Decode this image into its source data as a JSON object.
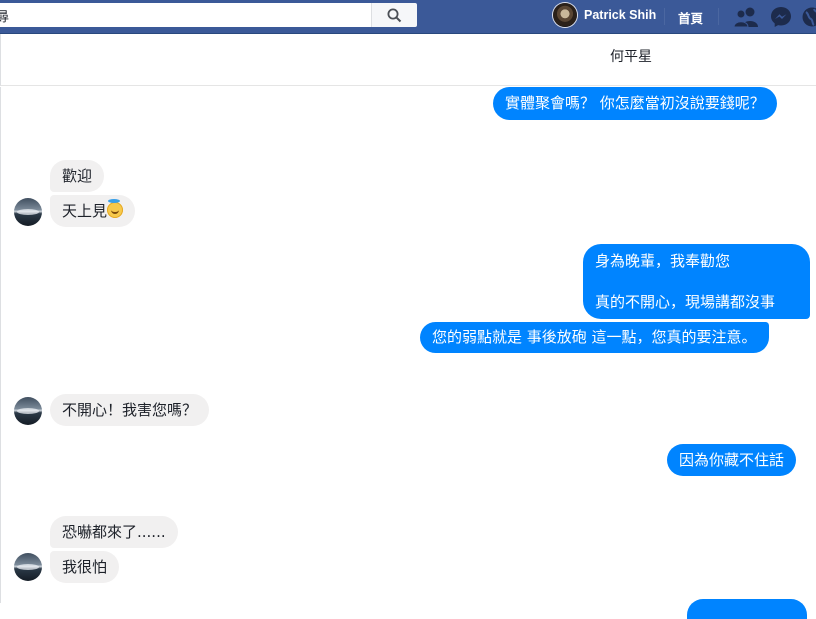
{
  "topbar": {
    "search_value": "尋",
    "search_icon": "search-icon",
    "profile_name": "Patrick Shih",
    "home_label": "首頁",
    "icons": [
      "friends-icon",
      "messenger-icon",
      "globe-icon"
    ],
    "brand_color": "#3b5998"
  },
  "conversation": {
    "title": "何平星"
  },
  "messages": [
    {
      "side": "out",
      "text": "實體聚會嗎？ 你怎麼當初沒說要錢呢？"
    },
    {
      "side": "in",
      "text": "歡迎"
    },
    {
      "side": "in",
      "text": "天上見",
      "emoji": "smiling-face-with-halo-emoji"
    },
    {
      "side": "out",
      "lines": [
        "身為晚輩，我奉勸您",
        "真的不開心，現場講都沒事"
      ]
    },
    {
      "side": "out",
      "text": "您的弱點就是 事後放砲 這一點，您真的要注意。"
    },
    {
      "side": "in",
      "text": "不開心！我害您嗎？"
    },
    {
      "side": "out",
      "text": "因為你藏不住話"
    },
    {
      "side": "in",
      "text": "恐嚇都來了......"
    },
    {
      "side": "in",
      "text": "我很怕"
    }
  ],
  "colors": {
    "outgoing_bubble": "#0084ff",
    "incoming_bubble": "#f1f0f0"
  }
}
